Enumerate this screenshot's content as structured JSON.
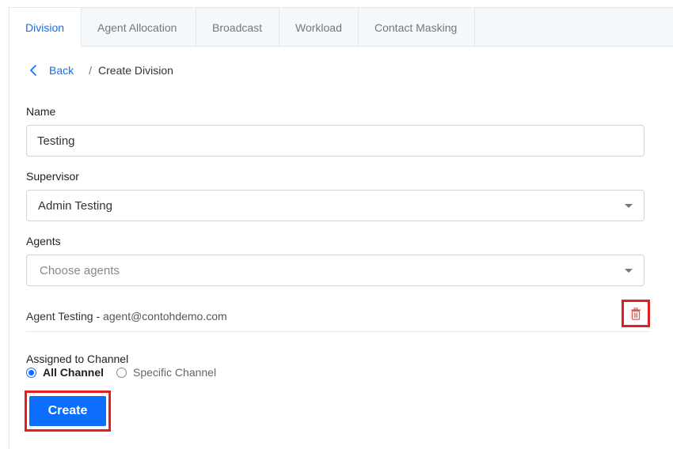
{
  "tabs": [
    {
      "label": "Division",
      "active": true
    },
    {
      "label": "Agent Allocation",
      "active": false
    },
    {
      "label": "Broadcast",
      "active": false
    },
    {
      "label": "Workload",
      "active": false
    },
    {
      "label": "Contact Masking",
      "active": false
    }
  ],
  "breadcrumb": {
    "back_label": "Back",
    "separator": "/",
    "current": "Create Division"
  },
  "form": {
    "name": {
      "label": "Name",
      "value": "Testing"
    },
    "supervisor": {
      "label": "Supervisor",
      "value": "Admin Testing"
    },
    "agents": {
      "label": "Agents",
      "placeholder": "Choose agents"
    },
    "selected_agents": [
      {
        "name": "Agent Testing",
        "separator": " - ",
        "email": "agent@contohdemo.com"
      }
    ],
    "channel": {
      "label": "Assigned to Channel",
      "options": [
        {
          "label": "All Channel",
          "checked": true
        },
        {
          "label": "Specific Channel",
          "checked": false
        }
      ]
    },
    "submit_label": "Create"
  },
  "colors": {
    "accent": "#0d6efd",
    "highlight": "#e02020",
    "delete": "#d9534f"
  },
  "icons": {
    "back": "chevron-left-icon",
    "delete": "trash-icon",
    "dropdown": "caret-down-icon"
  }
}
